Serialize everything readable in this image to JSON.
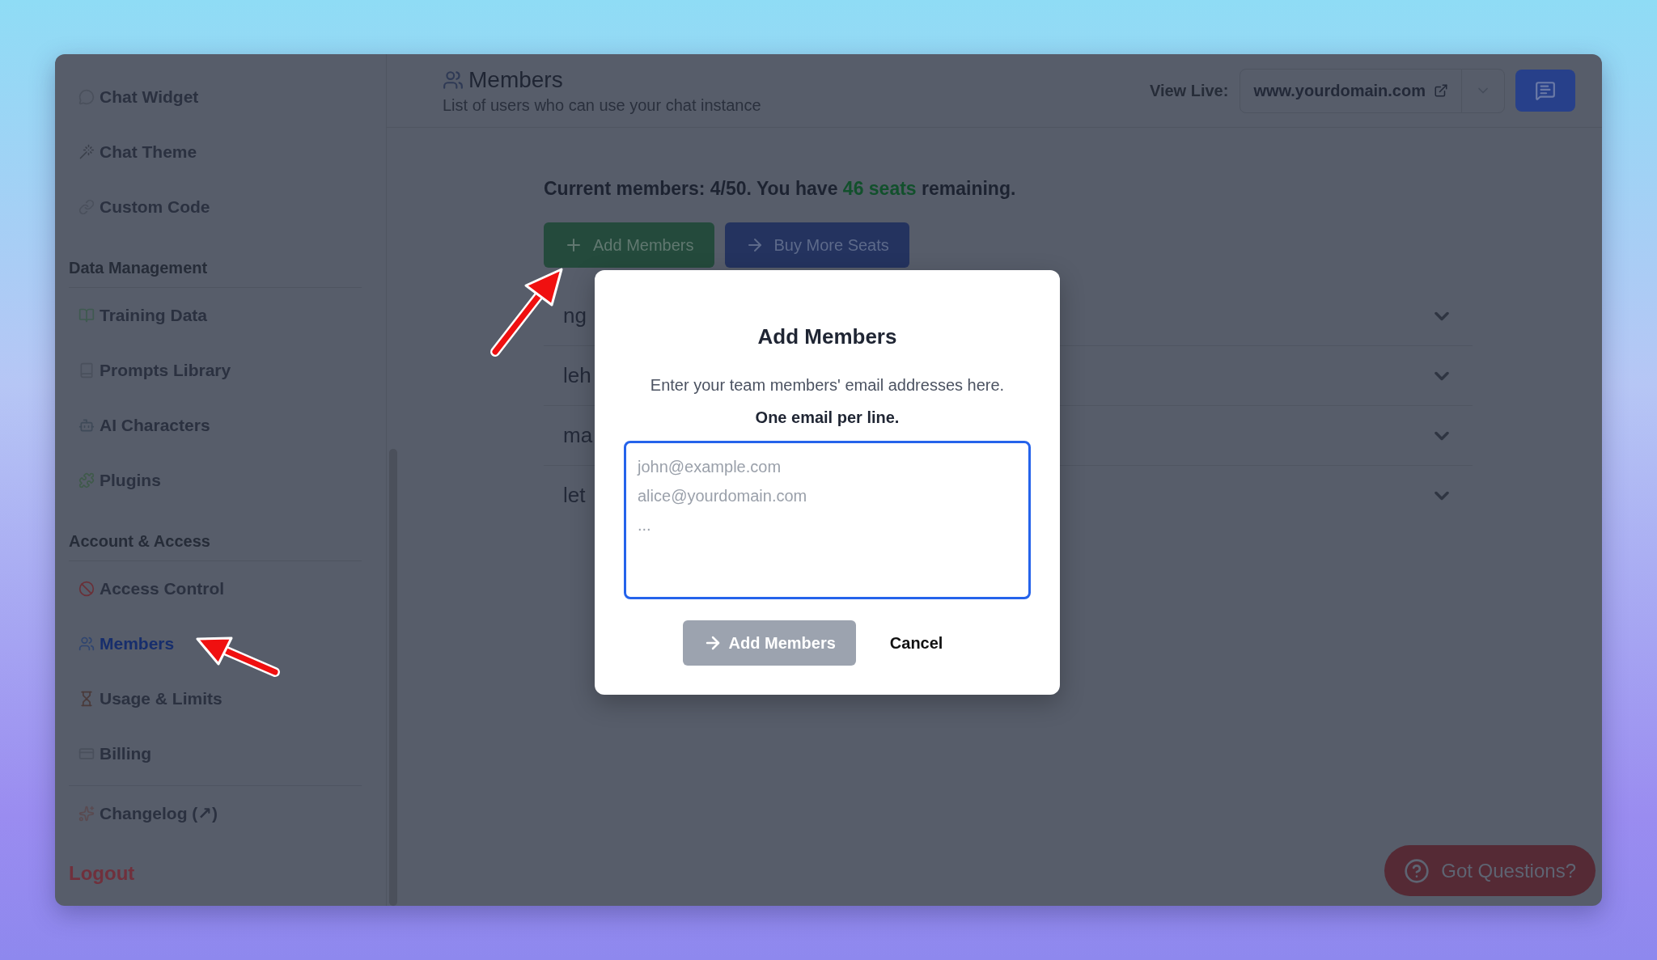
{
  "sidebar": {
    "sections": [
      {
        "items": [
          {
            "label": "Chat Widget",
            "selected": false
          },
          {
            "label": "Chat Theme",
            "selected": false
          },
          {
            "label": "Custom Code",
            "selected": false
          }
        ]
      },
      {
        "heading": "Data Management",
        "items": [
          {
            "label": "Training Data",
            "selected": false
          },
          {
            "label": "Prompts Library",
            "selected": false
          },
          {
            "label": "AI Characters",
            "selected": false
          },
          {
            "label": "Plugins",
            "selected": false
          }
        ]
      },
      {
        "heading": "Account & Access",
        "items": [
          {
            "label": "Access Control",
            "selected": false
          },
          {
            "label": "Members",
            "selected": true
          },
          {
            "label": "Usage & Limits",
            "selected": false
          },
          {
            "label": "Billing",
            "selected": false
          }
        ]
      },
      {
        "items": [
          {
            "label": "Changelog (↗)",
            "selected": false
          }
        ]
      }
    ],
    "logout": "Logout"
  },
  "header": {
    "title": "Members",
    "subtitle": "List of users who can use your chat instance",
    "view_live_label": "View Live:",
    "domain": "www.yourdomain.com"
  },
  "content": {
    "summary": "Current members: 4/50. You have **46 seats** remaining.",
    "add_button": "Add Members",
    "buy_button": "Buy More Seats",
    "members": [
      {
        "name": "ng"
      },
      {
        "name": "leh"
      },
      {
        "name": "ma"
      },
      {
        "name": "let"
      }
    ]
  },
  "modal": {
    "title": "Add Members",
    "description": "Enter your team members' email addresses here.",
    "note": "One email per line.",
    "placeholder": "john@example.com\nalice@yourdomain.com\n...",
    "submit": "Add Members",
    "submit_disabled": true,
    "cancel": "Cancel"
  },
  "help_button": "Got Questions?"
}
